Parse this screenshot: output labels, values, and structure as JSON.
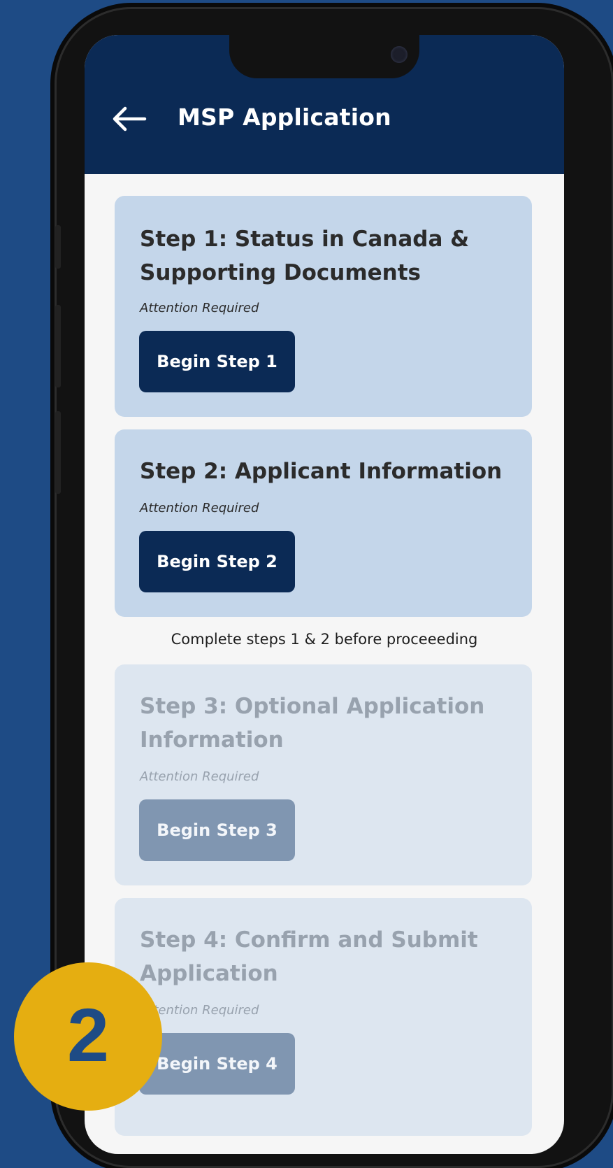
{
  "header": {
    "title": "MSP Application",
    "back_icon": "arrow-left-icon"
  },
  "steps": [
    {
      "title": "Step 1: Status in Canada & Supporting Documents",
      "status": "Attention Required",
      "button_label": "Begin Step 1",
      "enabled": true
    },
    {
      "title": "Step 2: Applicant Information",
      "status": "Attention Required",
      "button_label": "Begin Step 2",
      "enabled": true
    },
    {
      "title": "Step 3: Optional Application Information",
      "status": "Attention Required",
      "button_label": "Begin Step 3",
      "enabled": false
    },
    {
      "title": "Step 4: Confirm and Submit Application",
      "status": "Attention Required",
      "button_label": "Begin Step 4",
      "enabled": false
    }
  ],
  "note": "Complete steps 1 & 2 before proceeeding",
  "badge": "2",
  "colors": {
    "background": "#1e4b85",
    "header": "#0b2a55",
    "card_active": "#c4d6ea",
    "card_disabled": "#dde6f0",
    "button_active": "#0b2a55",
    "button_disabled": "#8096b1",
    "badge": "#e5ae11"
  }
}
